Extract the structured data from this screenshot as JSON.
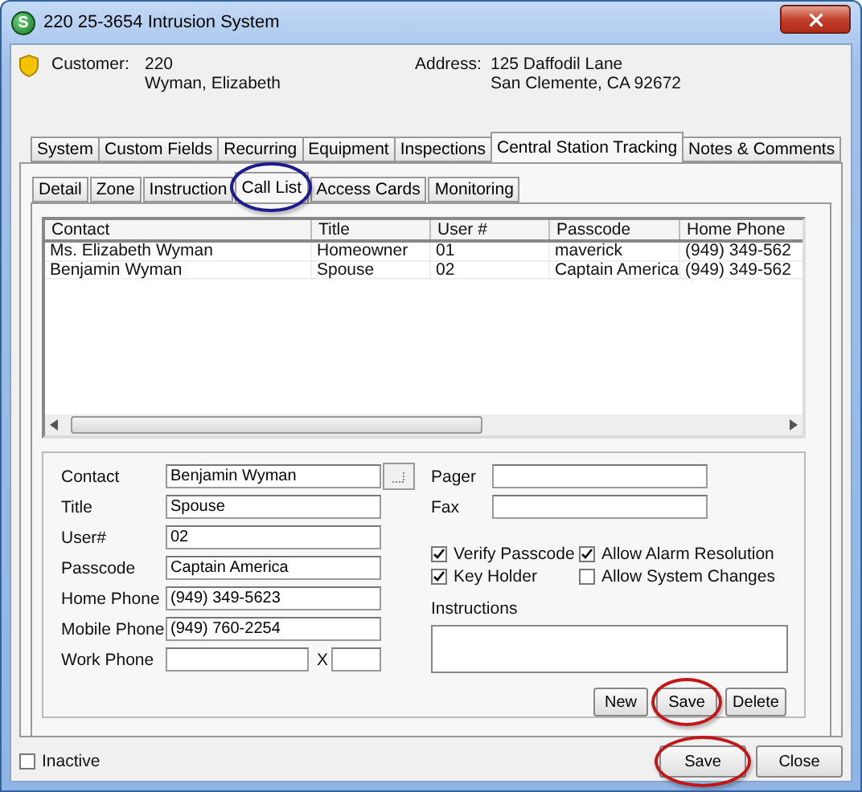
{
  "window": {
    "title": "220 25-3654 Intrusion System",
    "logo_letter": "S"
  },
  "customer": {
    "label": "Customer:",
    "number": "220",
    "name": "Wyman, Elizabeth"
  },
  "address": {
    "label": "Address:",
    "line1": "125 Daffodil Lane",
    "line2": "San Clemente, CA  92672"
  },
  "tabs": [
    {
      "label": "System",
      "selected": false
    },
    {
      "label": "Custom Fields",
      "selected": false
    },
    {
      "label": "Recurring",
      "selected": false
    },
    {
      "label": "Equipment",
      "selected": false
    },
    {
      "label": "Inspections",
      "selected": false
    },
    {
      "label": "Central Station Tracking",
      "selected": true
    },
    {
      "label": "Notes & Comments",
      "selected": false
    }
  ],
  "subtabs": [
    {
      "label": "Detail",
      "selected": false,
      "circled": false
    },
    {
      "label": "Zone",
      "selected": false,
      "circled": false
    },
    {
      "label": "Instruction",
      "selected": false,
      "circled": false
    },
    {
      "label": "Call List",
      "selected": true,
      "circled": true
    },
    {
      "label": "Access Cards",
      "selected": false,
      "circled": false
    },
    {
      "label": "Monitoring",
      "selected": false,
      "circled": false
    }
  ],
  "table": {
    "columns": [
      "Contact",
      "Title",
      "User #",
      "Passcode",
      "Home Phone"
    ],
    "rows": [
      [
        "Ms. Elizabeth Wyman",
        "Homeowner",
        "01",
        "maverick",
        "(949) 349-562"
      ],
      [
        "Benjamin Wyman",
        "Spouse",
        "02",
        "Captain America",
        "(949) 349-562"
      ]
    ]
  },
  "form": {
    "fields": [
      {
        "label": "Contact",
        "value": "Benjamin Wyman",
        "kind": "lookup"
      },
      {
        "label": "Title",
        "value": "Spouse",
        "kind": "text"
      },
      {
        "label": "User#",
        "value": "02",
        "kind": "text"
      },
      {
        "label": "Passcode",
        "value": "Captain America",
        "kind": "text"
      },
      {
        "label": "Home Phone",
        "value": "(949) 349-5623",
        "kind": "text"
      },
      {
        "label": "Mobile Phone",
        "value": "(949) 760-2254",
        "kind": "text"
      },
      {
        "label": "Work Phone",
        "kind": "phone",
        "extension_label": "X"
      }
    ],
    "right_fields": [
      {
        "label": "Pager"
      },
      {
        "label": "Fax"
      }
    ],
    "checkboxes": [
      {
        "label": "Verify Passcode",
        "checked": true
      },
      {
        "label": "Allow Alarm Resolution",
        "checked": true
      },
      {
        "label": "Key Holder",
        "checked": true
      },
      {
        "label": "Allow System Changes",
        "checked": false
      }
    ],
    "instructions": {
      "label": "Instructions"
    },
    "buttons": [
      {
        "label": "New",
        "circled": false
      },
      {
        "label": "Save",
        "circled": true
      },
      {
        "label": "Delete",
        "circled": false
      }
    ]
  },
  "inactive": {
    "label": "Inactive",
    "checked": false
  },
  "dialog_buttons": [
    {
      "label": "Save",
      "circled": true
    },
    {
      "label": "Close",
      "circled": false
    }
  ]
}
